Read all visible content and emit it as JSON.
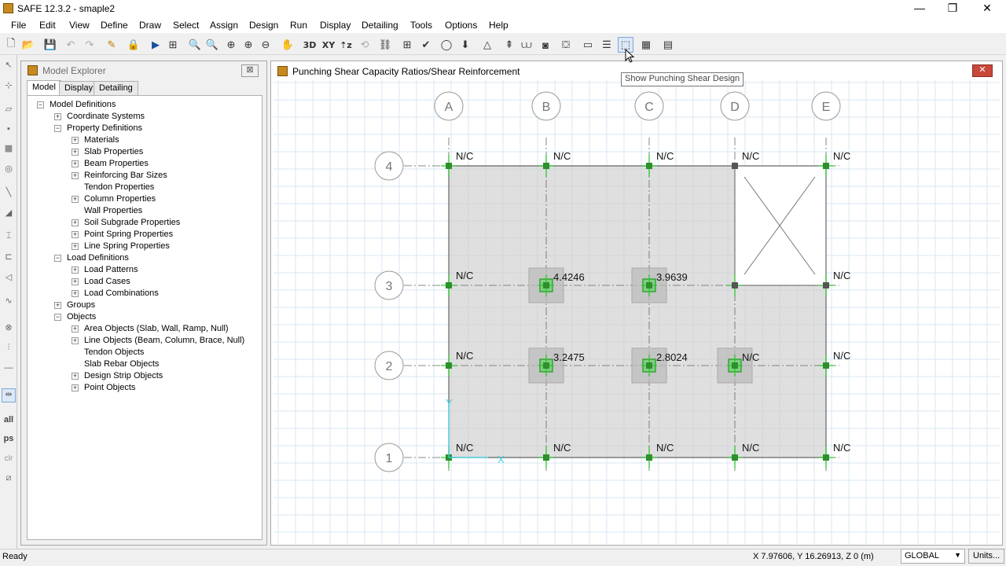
{
  "window": {
    "title": "SAFE 12.3.2 - smaple2",
    "minimize": "—",
    "restore": "❐",
    "close": "✕"
  },
  "menu": [
    "File",
    "Edit",
    "View",
    "Define",
    "Draw",
    "Select",
    "Assign",
    "Design",
    "Run",
    "Display",
    "Detailing",
    "Tools",
    "Options",
    "Help"
  ],
  "toolbar": {
    "btn_3d": "3D",
    "btn_xy": "XY",
    "btn_xz": "⇡z"
  },
  "lefttools": {
    "all": "all",
    "ps": "ps",
    "clr": "clr"
  },
  "explorer": {
    "title": "Model Explorer",
    "close": "⊠",
    "tabs": [
      "Model",
      "Display",
      "Detailing"
    ],
    "tree": [
      {
        "label": "Model Definitions",
        "level": 0,
        "exp": "−"
      },
      {
        "label": "Coordinate Systems",
        "level": 1,
        "exp": "+"
      },
      {
        "label": "Property Definitions",
        "level": 1,
        "exp": "−"
      },
      {
        "label": "Materials",
        "level": 2,
        "exp": "+"
      },
      {
        "label": "Slab Properties",
        "level": 2,
        "exp": "+"
      },
      {
        "label": "Beam Properties",
        "level": 2,
        "exp": "+"
      },
      {
        "label": "Reinforcing Bar Sizes",
        "level": 2,
        "exp": "+"
      },
      {
        "label": "Tendon Properties",
        "level": 2,
        "exp": ""
      },
      {
        "label": "Column Properties",
        "level": 2,
        "exp": "+"
      },
      {
        "label": "Wall Properties",
        "level": 2,
        "exp": ""
      },
      {
        "label": "Soil Subgrade Properties",
        "level": 2,
        "exp": "+"
      },
      {
        "label": "Point Spring Properties",
        "level": 2,
        "exp": "+"
      },
      {
        "label": "Line Spring Properties",
        "level": 2,
        "exp": "+"
      },
      {
        "label": "Load Definitions",
        "level": 1,
        "exp": "−"
      },
      {
        "label": "Load Patterns",
        "level": 2,
        "exp": "+"
      },
      {
        "label": "Load Cases",
        "level": 2,
        "exp": "+"
      },
      {
        "label": "Load Combinations",
        "level": 2,
        "exp": "+"
      },
      {
        "label": "Groups",
        "level": 1,
        "exp": "+"
      },
      {
        "label": "Objects",
        "level": 1,
        "exp": "−"
      },
      {
        "label": "Area Objects (Slab, Wall, Ramp, Null)",
        "level": 2,
        "exp": "+"
      },
      {
        "label": "Line Objects (Beam, Column, Brace, Null)",
        "level": 2,
        "exp": "+"
      },
      {
        "label": "Tendon Objects",
        "level": 2,
        "exp": ""
      },
      {
        "label": "Slab Rebar Objects",
        "level": 2,
        "exp": ""
      },
      {
        "label": "Design Strip Objects",
        "level": 2,
        "exp": "+"
      },
      {
        "label": "Point Objects",
        "level": 2,
        "exp": "+"
      }
    ]
  },
  "plan": {
    "title": "Punching Shear Capacity Ratios/Shear Reinforcement",
    "close": "✕",
    "tooltip": "Show Punching Shear Design",
    "grid_x": [
      "A",
      "B",
      "C",
      "D",
      "E"
    ],
    "grid_y": [
      "4",
      "3",
      "2",
      "1"
    ],
    "labels": {
      "r4": [
        "N/C",
        "N/C",
        "N/C",
        "N/C",
        "N/C"
      ],
      "r3": [
        "N/C",
        "4.4246",
        "3.9639",
        "N/C"
      ],
      "r2": [
        "N/C",
        "3.2475",
        "2.8024",
        "N/C",
        "N/C"
      ],
      "r1": [
        "N/C",
        "N/C",
        "N/C",
        "N/C",
        "N/C"
      ]
    },
    "axis_x": "X",
    "axis_y": "Y"
  },
  "status": {
    "ready": "Ready",
    "coords": "X 7.97606,  Y 16.26913,  Z 0  (m)",
    "coord_system": "GLOBAL",
    "units": "Units..."
  }
}
